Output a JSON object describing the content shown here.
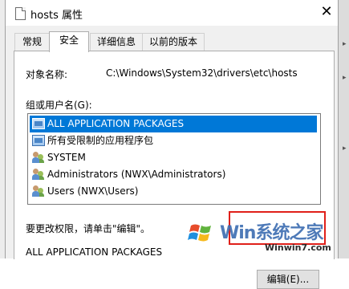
{
  "window": {
    "title": "hosts 属性",
    "close_glyph": "✕"
  },
  "tabs": [
    {
      "label": "常规"
    },
    {
      "label": "安全"
    },
    {
      "label": "详细信息"
    },
    {
      "label": "以前的版本"
    }
  ],
  "security": {
    "object_label": "对象名称:",
    "object_value": "C:\\Windows\\System32\\drivers\\etc\\hosts",
    "group_label": "组或用户名(G):",
    "users": [
      {
        "name": "ALL APPLICATION PACKAGES",
        "icon": "app-package-icon",
        "selected": true
      },
      {
        "name": "所有受限制的应用程序包",
        "icon": "app-package-icon",
        "selected": false
      },
      {
        "name": "SYSTEM",
        "icon": "users-icon",
        "selected": false
      },
      {
        "name": "Administrators (NWX\\Administrators)",
        "icon": "users-icon",
        "selected": false
      },
      {
        "name": "Users (NWX\\Users)",
        "icon": "users-icon",
        "selected": false
      }
    ],
    "change_hint": "要更改权限，请单击\"编辑\"。",
    "edit_button": "编辑(E)...",
    "permissions_for": "ALL APPLICATION PACKAGES"
  },
  "watermark": {
    "brand": "Win系统之家",
    "site": "Winwin7.com"
  },
  "colors": {
    "selection": "#0078d7",
    "highlight_box": "#e0201a",
    "watermark_blue": "#3f6fb3"
  }
}
